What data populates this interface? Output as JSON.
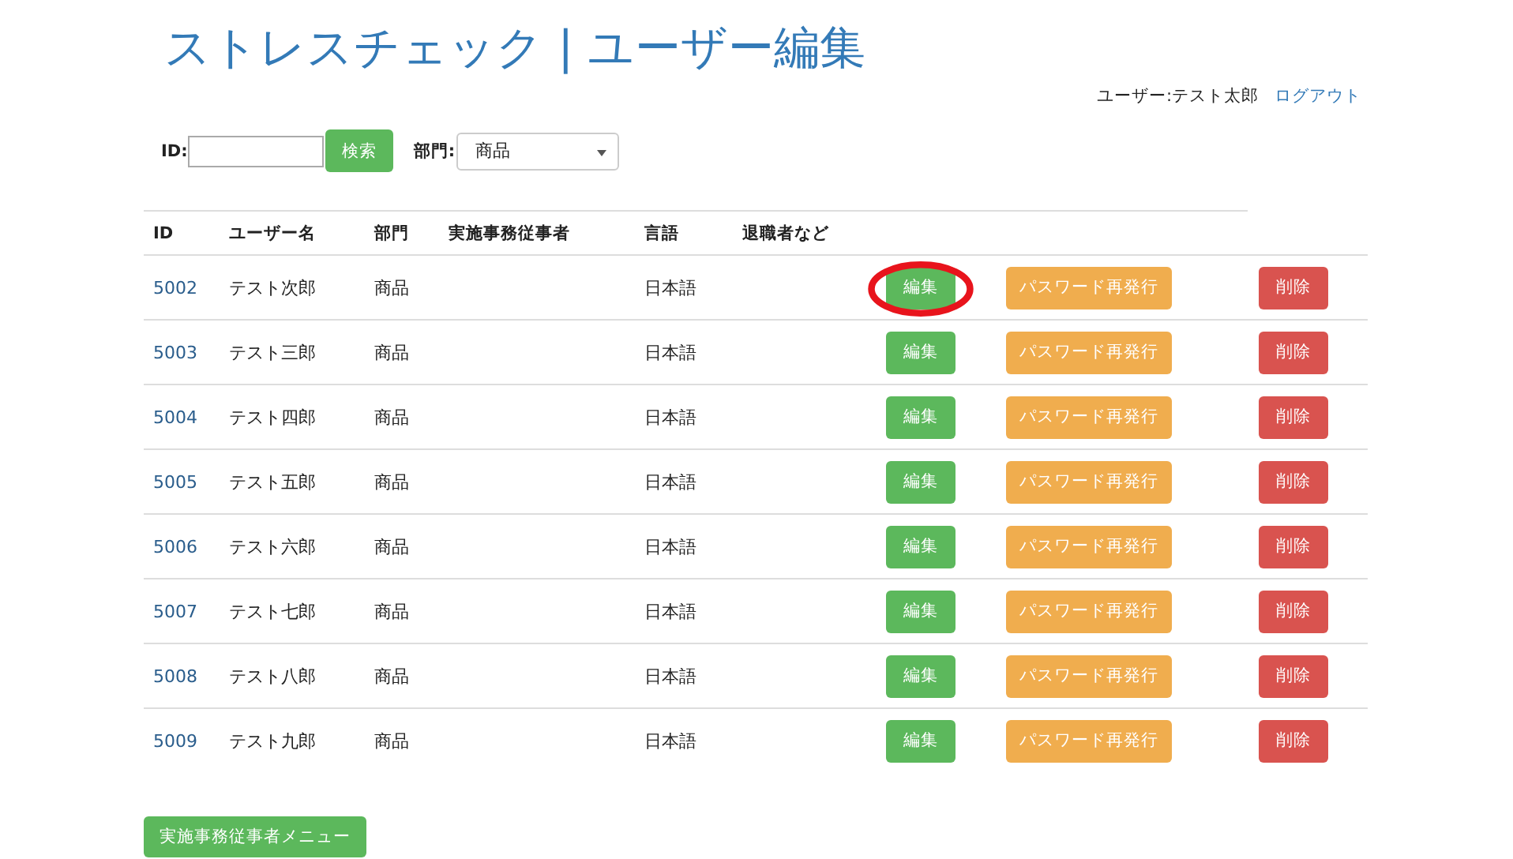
{
  "title": "ストレスチェック | ユーザー編集",
  "user_bar": {
    "user": "ユーザー:テスト太郎",
    "logout": "ログアウト"
  },
  "search": {
    "id_label": "ID:",
    "search_button": "検索",
    "dept_label": "部門:",
    "dept_value": "商品"
  },
  "table": {
    "columns": [
      "ID",
      "ユーザー名",
      "部門",
      "実施事務従事者",
      "言語",
      "退職者など"
    ],
    "rows": [
      {
        "id": "5002",
        "name": "テスト次郎",
        "dept": "商品",
        "lang": "日本語",
        "edit": "編集",
        "reset": "パスワード再発行",
        "delete": "削除",
        "circled": true
      },
      {
        "id": "5003",
        "name": "テスト三郎",
        "dept": "商品",
        "lang": "日本語",
        "edit": "編集",
        "reset": "パスワード再発行",
        "delete": "削除",
        "circled": false
      },
      {
        "id": "5004",
        "name": "テスト四郎",
        "dept": "商品",
        "lang": "日本語",
        "edit": "編集",
        "reset": "パスワード再発行",
        "delete": "削除",
        "circled": false
      },
      {
        "id": "5005",
        "name": "テスト五郎",
        "dept": "商品",
        "lang": "日本語",
        "edit": "編集",
        "reset": "パスワード再発行",
        "delete": "削除",
        "circled": false
      },
      {
        "id": "5006",
        "name": "テスト六郎",
        "dept": "商品",
        "lang": "日本語",
        "edit": "編集",
        "reset": "パスワード再発行",
        "delete": "削除",
        "circled": false
      },
      {
        "id": "5007",
        "name": "テスト七郎",
        "dept": "商品",
        "lang": "日本語",
        "edit": "編集",
        "reset": "パスワード再発行",
        "delete": "削除",
        "circled": false
      },
      {
        "id": "5008",
        "name": "テスト八郎",
        "dept": "商品",
        "lang": "日本語",
        "edit": "編集",
        "reset": "パスワード再発行",
        "delete": "削除",
        "circled": false
      },
      {
        "id": "5009",
        "name": "テスト九郎",
        "dept": "商品",
        "lang": "日本語",
        "edit": "編集",
        "reset": "パスワード再発行",
        "delete": "削除",
        "circled": false
      }
    ]
  },
  "menu_button": "実施事務従事者メニュー"
}
